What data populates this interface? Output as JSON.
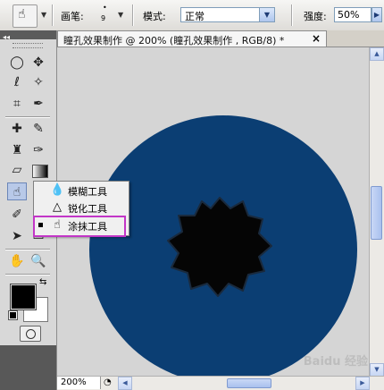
{
  "options_bar": {
    "brush_label": "画笔:",
    "brush_size": "9",
    "mode_label": "模式:",
    "mode_value": "正常",
    "strength_label": "强度:",
    "strength_value": "50%"
  },
  "document": {
    "tab_title": "瞳孔效果制作 @ 200% (瞳孔效果制作 , RGB/8) *",
    "close_glyph": "×",
    "zoom": "200%"
  },
  "flyout": {
    "items": [
      {
        "label": "模糊工具",
        "icon": "blur-drop-icon",
        "selected": false
      },
      {
        "label": "锐化工具",
        "icon": "sharpen-cone-icon",
        "selected": false
      },
      {
        "label": "涂抹工具",
        "icon": "smudge-finger-icon",
        "selected": true
      }
    ]
  },
  "colors": {
    "iris": "#0b3e73",
    "pupil": "#050505",
    "highlight_box": "#c236c7",
    "foreground": "#000000",
    "background": "#ffffff"
  },
  "watermark": "Baidu 经验"
}
